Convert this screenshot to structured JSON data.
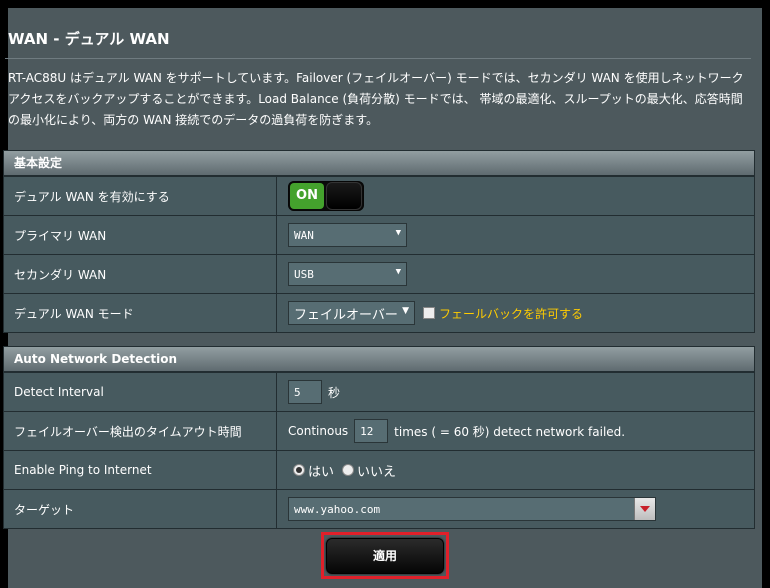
{
  "page": {
    "title": "WAN - デュアル WAN",
    "description": "RT-AC88U はデュアル WAN をサポートしています。Failover (フェイルオーバー) モードでは、セカンダリ WAN を使用しネットワークアクセスをバックアップすることができます。Load Balance (負荷分散) モードでは、 帯域の最適化、スループットの最大化、応答時間の最小化により、両方の WAN 接続でのデータの過負荷を防ぎます。"
  },
  "basic": {
    "header": "基本設定",
    "enable_label": "デュアル WAN を有効にする",
    "enable_state": "ON",
    "primary_label": "プライマリ WAN",
    "primary_value": "WAN",
    "secondary_label": "セカンダリ WAN",
    "secondary_value": "USB",
    "mode_label": "デュアル WAN モード",
    "mode_value": "フェイルオーバー",
    "fallback_label": "フェールバックを許可する",
    "fallback_checked": false
  },
  "detect": {
    "header": "Auto Network Detection",
    "interval_label": "Detect Interval",
    "interval_value": "5",
    "interval_unit": "秒",
    "timeout_label": "フェイルオーバー検出のタイムアウト時間",
    "timeout_prefix": "Continous",
    "timeout_value": "12",
    "timeout_suffix": "times ( = 60  秒) detect network failed.",
    "ping_label": "Enable Ping to Internet",
    "ping_yes": "はい",
    "ping_no": "いいえ",
    "ping_selected": "yes",
    "target_label": "ターゲット",
    "target_value": "www.yahoo.com"
  },
  "actions": {
    "apply_label": "適用"
  },
  "colors": {
    "panel_bg": "#4d595d",
    "on_green": "#44a22d",
    "link_yellow": "#ffcc00",
    "highlight_red": "#e0202a"
  }
}
